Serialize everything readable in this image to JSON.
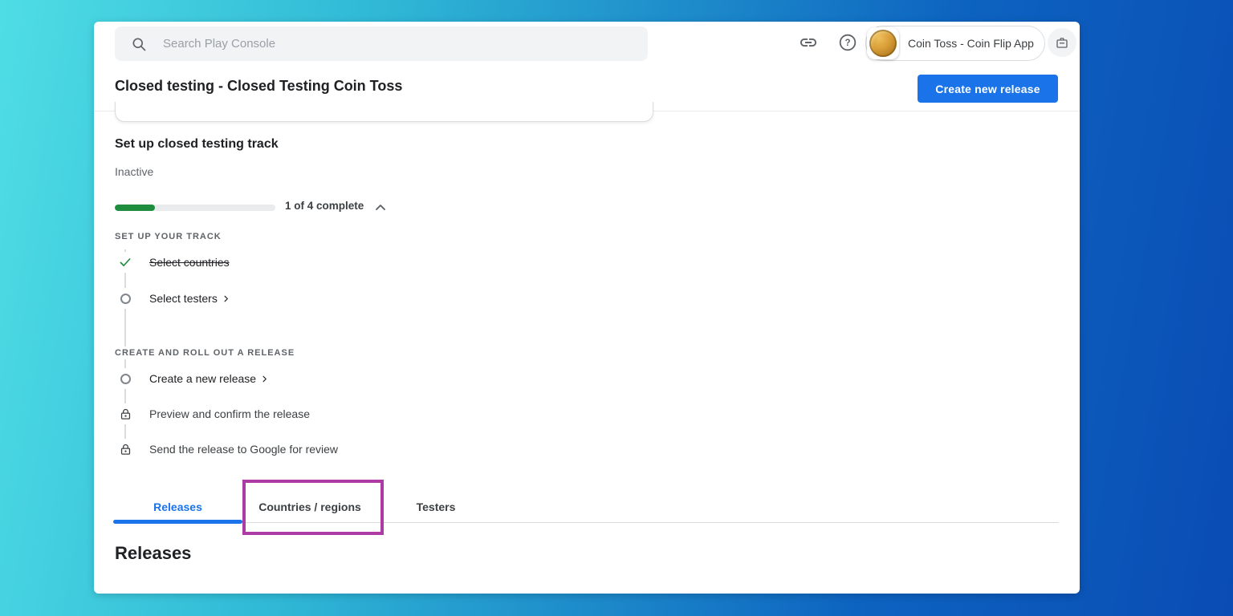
{
  "background": {
    "gradient_left": "#4fdde5",
    "gradient_right": "#0a4cb4"
  },
  "topbar": {
    "search_placeholder": "Search Play Console",
    "app_label": "Coin Toss - Coin Flip App"
  },
  "header": {
    "title": "Closed testing - Closed Testing Coin Toss",
    "create_button": "Create new release"
  },
  "setup": {
    "title": "Set up closed testing track",
    "status": "Inactive",
    "progress": {
      "complete": 1,
      "total": 4,
      "label": "1 of 4 complete",
      "percent": 25
    },
    "sections": [
      {
        "heading": "SET UP YOUR TRACK",
        "items": [
          {
            "label": "Select countries",
            "state": "done"
          },
          {
            "label": "Select testers",
            "state": "todo",
            "chevron": true
          }
        ]
      },
      {
        "heading": "CREATE AND ROLL OUT A RELEASE",
        "items": [
          {
            "label": "Create a new release",
            "state": "todo",
            "chevron": true
          },
          {
            "label": "Preview and confirm the release",
            "state": "locked"
          },
          {
            "label": "Send the release to Google for review",
            "state": "locked"
          }
        ]
      }
    ]
  },
  "tabs": [
    {
      "label": "Releases",
      "active": true
    },
    {
      "label": "Countries / regions",
      "active": false,
      "highlighted": true
    },
    {
      "label": "Testers",
      "active": false
    }
  ],
  "content": {
    "heading": "Releases"
  },
  "colors": {
    "accent_blue": "#1a73e8",
    "progress_green": "#1e8e3e",
    "check_green": "#1e8e3e",
    "annotation_magenta": "#ae3aa4",
    "searchbar_gray": "#f1f3f4"
  },
  "icons": {
    "search": "magnifier",
    "link": "chain-link",
    "help": "question-mark-circle",
    "app_switcher_avatar": "gold-coin",
    "inbox_button": "briefcase",
    "collapse": "chevron-up",
    "done": "green-check",
    "todo": "empty-circle",
    "locked": "padlock",
    "goto": "chevron-right"
  }
}
